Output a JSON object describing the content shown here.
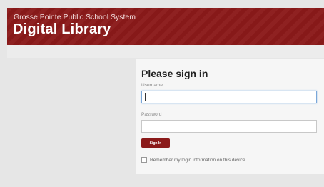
{
  "header": {
    "org_name": "Grosse Pointe Public School System",
    "app_title": "Digital Library"
  },
  "login": {
    "heading": "Please sign in",
    "username_label": "Username",
    "username_value": "",
    "password_label": "Password",
    "password_value": "",
    "sign_in_label": "Sign In",
    "remember_label": "Remember my login information on this device.",
    "remember_checked": false
  },
  "colors": {
    "brand": "#8b1a1a",
    "background": "#e6e6e6",
    "panel": "#f6f6f6"
  }
}
